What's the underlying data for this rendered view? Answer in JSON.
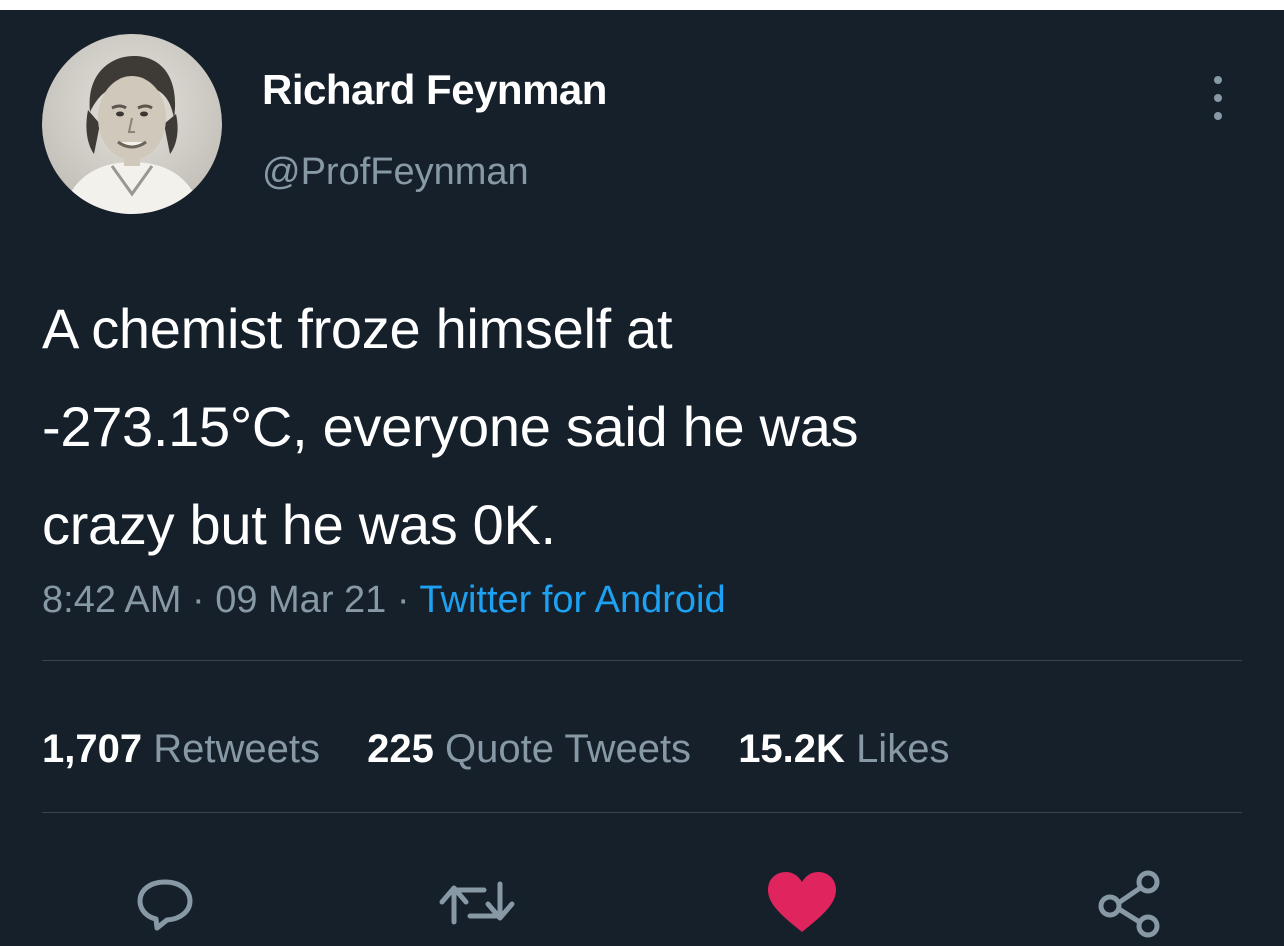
{
  "tweet": {
    "author": {
      "display_name": "Richard Feynman",
      "handle": "@ProfFeynman"
    },
    "text_lines": [
      "A chemist froze himself at",
      "-273.15°C, everyone said he was",
      "crazy but he was 0K."
    ],
    "time": "8:42 AM",
    "separator": " · ",
    "date": "09 Mar 21",
    "source": "Twitter for Android",
    "stats": {
      "retweets_count": "1,707",
      "retweets_label": "Retweets",
      "quotes_count": "225",
      "quotes_label": "Quote Tweets",
      "likes_count": "15.2K",
      "likes_label": "Likes"
    },
    "liked": true
  },
  "colors": {
    "background": "#15202b",
    "secondary_text": "#8899a6",
    "link": "#1da1f2",
    "like": "#e0245e",
    "divider": "#38444d"
  },
  "icons": {
    "more": "more-vertical-icon",
    "reply": "reply-icon",
    "retweet": "retweet-icon",
    "like": "heart-filled-icon",
    "share": "share-icon"
  }
}
